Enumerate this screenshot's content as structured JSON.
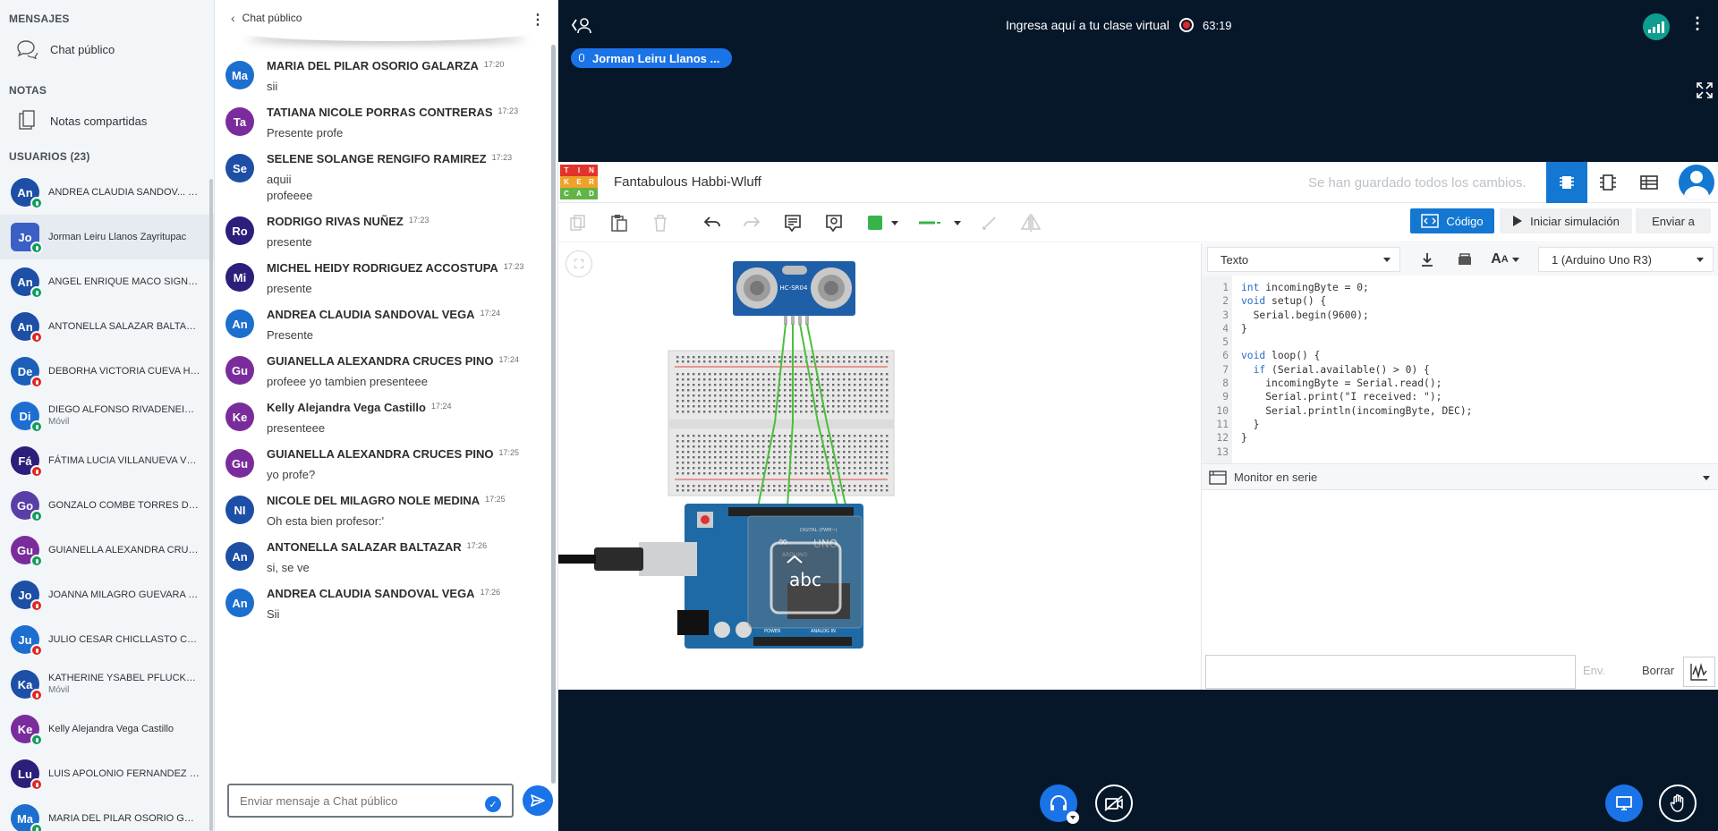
{
  "sidebar": {
    "mensajes_title": "MENSAJES",
    "chat_label": "Chat público",
    "notas_title": "NOTAS",
    "notas_label": "Notas compartidas",
    "usuarios_title": "USUARIOS (23)",
    "users": [
      {
        "initials": "An",
        "name": "ANDREA CLAUDIA SANDOV...",
        "tag": "(Usted)",
        "sub": "",
        "color": "#1c4fa5",
        "mic": "on"
      },
      {
        "initials": "Jo",
        "name": "Jorman Leiru Llanos Zayritupac",
        "tag": "",
        "sub": "",
        "color": "#3b5fc4",
        "mic": "on"
      },
      {
        "initials": "An",
        "name": "ANGEL ENRIQUE MACO SIGNORI",
        "tag": "",
        "sub": "",
        "color": "#1c4fa5",
        "mic": "on"
      },
      {
        "initials": "An",
        "name": "ANTONELLA SALAZAR BALTAZAR",
        "tag": "",
        "sub": "",
        "color": "#1c4fa5",
        "mic": "off"
      },
      {
        "initials": "De",
        "name": "DEBORHA VICTORIA CUEVA HUAPA...",
        "tag": "",
        "sub": "",
        "color": "#1c5fb8",
        "mic": "off"
      },
      {
        "initials": "Di",
        "name": "DIEGO ALFONSO RIVADENEIRA TU...",
        "tag": "",
        "sub": "Móvil",
        "color": "#1d6ed1",
        "mic": "on"
      },
      {
        "initials": "Fá",
        "name": "FÁTIMA LUCIA VILLANUEVA VENEG...",
        "tag": "",
        "sub": "",
        "color": "#2a1f7a",
        "mic": "off"
      },
      {
        "initials": "Go",
        "name": "GONZALO COMBE TORRES DELLA ...",
        "tag": "",
        "sub": "",
        "color": "#5a3ea8",
        "mic": "on"
      },
      {
        "initials": "Gu",
        "name": "GUIANELLA ALEXANDRA CRUCES P...",
        "tag": "",
        "sub": "",
        "color": "#7b2c9c",
        "mic": "on"
      },
      {
        "initials": "Jo",
        "name": "JOANNA MILAGRO GUEVARA ROD...",
        "tag": "",
        "sub": "",
        "color": "#1c4fa5",
        "mic": "off"
      },
      {
        "initials": "Ju",
        "name": "JULIO CESAR CHICLLASTO CHIPANA",
        "tag": "",
        "sub": "",
        "color": "#1d6ed1",
        "mic": "off"
      },
      {
        "initials": "Ka",
        "name": "KATHERINE YSABEL PFLUCKER GU...",
        "tag": "",
        "sub": "Móvil",
        "color": "#1c4fa5",
        "mic": "off"
      },
      {
        "initials": "Ke",
        "name": "Kelly Alejandra Vega Castillo",
        "tag": "",
        "sub": "",
        "color": "#7b2c9c",
        "mic": "on"
      },
      {
        "initials": "Lu",
        "name": "LUIS APOLONIO FERNANDEZ VARG...",
        "tag": "",
        "sub": "",
        "color": "#2a1f7a",
        "mic": "off"
      },
      {
        "initials": "Ma",
        "name": "MARIA DEL PILAR OSORIO GALARZA",
        "tag": "",
        "sub": "",
        "color": "#1c6fcf",
        "mic": "on"
      }
    ]
  },
  "chat": {
    "title": "Chat público",
    "input_placeholder": "Enviar mensaje a Chat público",
    "messages": [
      {
        "initials": "Ma",
        "color": "#1c6fcf",
        "name": "MARIA DEL PILAR OSORIO GALARZA",
        "time": "17:20",
        "lines": [
          "sii"
        ]
      },
      {
        "initials": "Ta",
        "color": "#7b2c9c",
        "name": "TATIANA NICOLE PORRAS CONTRERAS",
        "time": "17:23",
        "lines": [
          "Presente profe"
        ]
      },
      {
        "initials": "Se",
        "color": "#1c4fa5",
        "name": "SELENE SOLANGE RENGIFO RAMIREZ",
        "time": "17:23",
        "lines": [
          "aquii",
          "profeeee"
        ]
      },
      {
        "initials": "Ro",
        "color": "#2a1f7a",
        "name": "RODRIGO RIVAS NUÑEZ",
        "time": "17:23",
        "lines": [
          "presente"
        ]
      },
      {
        "initials": "Mi",
        "color": "#2a1f7a",
        "name": "MICHEL HEIDY RODRIGUEZ ACCOSTUPA",
        "time": "17:23",
        "lines": [
          "presente"
        ]
      },
      {
        "initials": "An",
        "color": "#1c6fcf",
        "name": "ANDREA CLAUDIA SANDOVAL VEGA",
        "time": "17:24",
        "lines": [
          "Presente"
        ]
      },
      {
        "initials": "Gu",
        "color": "#7b2c9c",
        "name": "GUIANELLA ALEXANDRA CRUCES PINO",
        "time": "17:24",
        "lines": [
          "profeee yo tambien presenteee"
        ]
      },
      {
        "initials": "Ke",
        "color": "#7b2c9c",
        "name": "Kelly Alejandra Vega Castillo",
        "time": "17:24",
        "lines": [
          "presenteee"
        ]
      },
      {
        "initials": "Gu",
        "color": "#7b2c9c",
        "name": "GUIANELLA ALEXANDRA CRUCES PINO",
        "time": "17:25",
        "lines": [
          "yo profe?"
        ]
      },
      {
        "initials": "NI",
        "color": "#1c4fa5",
        "name": "NICOLE DEL MILAGRO NOLE MEDINA",
        "time": "17:25",
        "lines": [
          "Oh esta bien profesor:'"
        ]
      },
      {
        "initials": "An",
        "color": "#1c4fa5",
        "name": "ANTONELLA SALAZAR BALTAZAR",
        "time": "17:26",
        "lines": [
          "si, se ve"
        ]
      },
      {
        "initials": "An",
        "color": "#1c6fcf",
        "name": "ANDREA CLAUDIA SANDOVAL VEGA",
        "time": "17:26",
        "lines": [
          "Sii"
        ]
      }
    ]
  },
  "meeting": {
    "title": "Ingresa aquí a tu clase virtual",
    "timer": "63:19",
    "presenter": "Jorman Leiru Llanos ..."
  },
  "tinkercad": {
    "logo_letters": [
      "T",
      "I",
      "N",
      "K",
      "E",
      "R",
      "C",
      "A",
      "D"
    ],
    "logo_colors": [
      "#e2342b",
      "#e2342b",
      "#e2342b",
      "#f0a12a",
      "#f0a12a",
      "#f0a12a",
      "#62b446",
      "#62b446",
      "#62b446"
    ],
    "project_name": "Fantabulous Habbi-Wluff",
    "saved_status": "Se han guardado todos los cambios.",
    "code_button": "Código",
    "simulate_button": "Iniciar simulación",
    "send_button": "Enviar a",
    "editor_mode": "Texto",
    "board_select": "1 (Arduino Uno R3)",
    "line_numbers": [
      "1",
      "2",
      "3",
      "4",
      "5",
      "6",
      "7",
      "8",
      "9",
      "10",
      "11",
      "12",
      "13"
    ],
    "code_lines": [
      "int incomingByte = 0;",
      "void setup() {",
      "  Serial.begin(9600);",
      "}",
      "",
      "void loop() {",
      "  if (Serial.available() > 0) {",
      "    incomingByte = Serial.read();",
      "    Serial.print(\"I received: \");",
      "    Serial.println(incomingByte, DEC);",
      "  }",
      "}",
      ""
    ],
    "serial_monitor_title": "Monitor en serie",
    "env_button": "Env.",
    "borrar_button": "Borrar",
    "sensor_label": "HC-SR04",
    "board_labels": {
      "brand": "ARDUINO",
      "model": "UNO",
      "digital": "DIGITAL (PWM~)",
      "power": "POWER",
      "analog": "ANALOG IN"
    },
    "overlay_text": "abc"
  }
}
